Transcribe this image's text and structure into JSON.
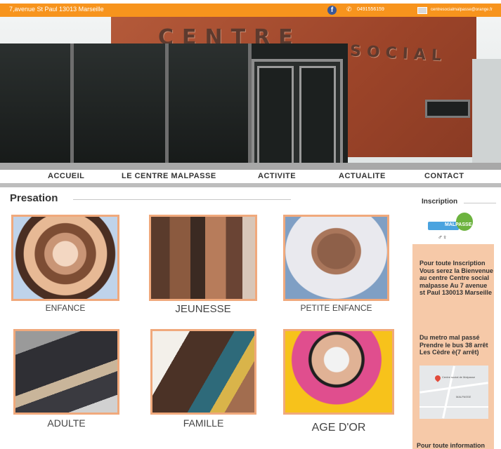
{
  "topbar": {
    "address": "7,avenue St Paul 13013 Marseille",
    "facebook_icon": "facebook-icon",
    "phone_icon": "phone-icon",
    "phone": "0491556159",
    "mail_icon": "mail-icon",
    "email": "centresocialmalpasse@orange.fr",
    "color": "#f7941d"
  },
  "hero": {
    "sign_word1": "CENTRE",
    "sign_word2": "SOCIAL"
  },
  "nav": {
    "items": [
      "ACCUEIL",
      "LE CENTRE MALPASSE",
      "ACTIVITE",
      "ACTUALITE",
      "CONTACT"
    ]
  },
  "main": {
    "section_title": "Presation",
    "cards": [
      {
        "label": "ENFANCE"
      },
      {
        "label": "JEUNESSE"
      },
      {
        "label": "PETITE ENFANCE"
      },
      {
        "label": "ADULTE"
      },
      {
        "label": "FAMILLE"
      },
      {
        "label": "AGE D'OR"
      }
    ],
    "accent": "#f0a97c"
  },
  "sidebar": {
    "title": "Inscription",
    "logo_text": "MALPASSE",
    "box_color": "#f6c9a8",
    "para1": "Pour toute Inscription Vous serez la Bienvenue au centre Centre social  malpasse Au 7 avenue st Paul 130013 Marseille",
    "para2": "Du metro mal passé Prendre le bus 38 arrêt Les Cèdre è(7 arrêt)",
    "map_label_main": "Centre social de Malpasse",
    "map_label_area": "MALPASSE",
    "footer": "Pour toute information"
  }
}
